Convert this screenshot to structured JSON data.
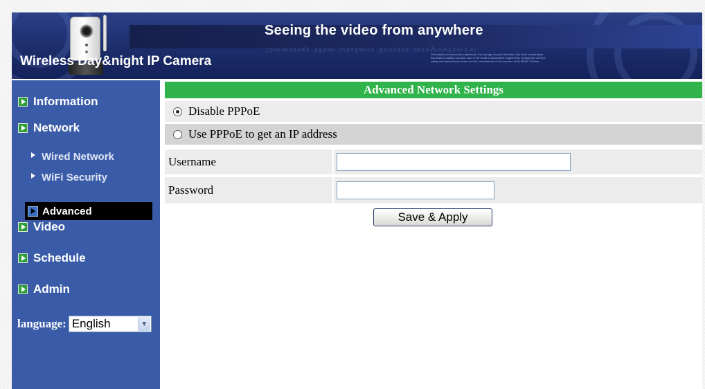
{
  "banner": {
    "tagline": "Seeing the video from anywhere",
    "product_name": "Wireless Day&night IP Camera",
    "blurb": "The solution to learn from experience, the courage to push the limits, this is the combination that leads to lasting success, also in the world of automotive engineering. Design and comfort, safety and performance, these are the cornerstones of the success of the BMW 3 Series."
  },
  "sidebar": {
    "items": [
      {
        "label": "Information",
        "icon": "play-square-icon"
      },
      {
        "label": "Network",
        "icon": "play-square-icon"
      },
      {
        "label": "Video",
        "icon": "play-square-icon"
      },
      {
        "label": "Schedule",
        "icon": "play-square-icon"
      },
      {
        "label": "Admin",
        "icon": "play-square-icon"
      }
    ],
    "network_subitems": [
      {
        "label": "Wired Network",
        "icon": "triangle-arrow-icon"
      },
      {
        "label": "WiFi Security",
        "icon": "triangle-arrow-icon"
      },
      {
        "label": "Advanced",
        "icon": "play-square-icon",
        "active": true
      }
    ],
    "language_label": "language:",
    "language_value": "English"
  },
  "main": {
    "section_title": "Advanced Network Settings",
    "pppoe_options": [
      {
        "label": "Disable PPPoE",
        "selected": true
      },
      {
        "label": "Use PPPoE to get an IP address",
        "selected": false
      }
    ],
    "username_label": "Username",
    "username_value": "",
    "password_label": "Password",
    "password_value": "",
    "save_label": "Save & Apply"
  },
  "colors": {
    "sidebar_bg": "#3a5ca8",
    "header_green": "#2fb34a",
    "active_item_bg": "#000000",
    "banner_bg": "#1c2d6b"
  }
}
